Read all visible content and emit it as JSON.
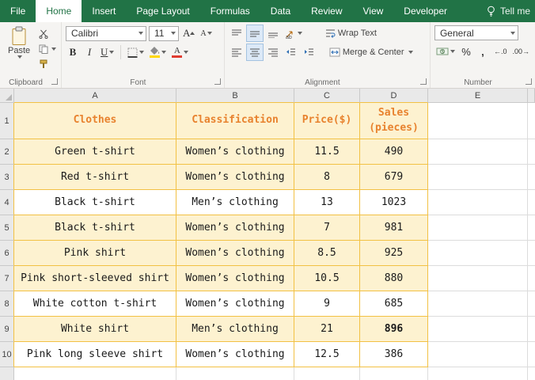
{
  "colors": {
    "excel_green": "#217346",
    "table_border": "#f2c144",
    "header_fill": "#fdf2d0",
    "header_text": "#e8822e"
  },
  "ribbon": {
    "tabs": [
      "File",
      "Home",
      "Insert",
      "Page Layout",
      "Formulas",
      "Data",
      "Review",
      "View",
      "Developer"
    ],
    "active_tab": "Home",
    "tell_me": "Tell me",
    "groups": {
      "clipboard": {
        "label": "Clipboard",
        "paste": "Paste"
      },
      "font": {
        "label": "Font",
        "name": "Calibri",
        "size": "11",
        "bold": "B",
        "italic": "I",
        "underline": "U"
      },
      "alignment": {
        "label": "Alignment",
        "wrap_text": "Wrap Text",
        "merge_center": "Merge & Center"
      },
      "number": {
        "label": "Number",
        "format": "General",
        "percent": "%",
        "comma": ","
      }
    }
  },
  "icons": {
    "letter_a": "A",
    "increase_decimal": "←.0",
    "decrease_decimal": ".00→"
  },
  "sheet": {
    "column_letters": [
      "A",
      "B",
      "C",
      "D",
      "E"
    ],
    "header_row_number": "1",
    "headers": [
      "Clothes",
      "Classification",
      "Price($)",
      "Sales (pieces)"
    ],
    "rows": [
      {
        "n": "2",
        "cells": [
          "Green t-shirt",
          "Women’s clothing",
          "11.5",
          "490"
        ],
        "fill": true
      },
      {
        "n": "3",
        "cells": [
          "Red t-shirt",
          "Women’s clothing",
          "8",
          "679"
        ],
        "fill": true
      },
      {
        "n": "4",
        "cells": [
          "Black t-shirt",
          "Men’s clothing",
          "13",
          "1023"
        ],
        "fill": false
      },
      {
        "n": "5",
        "cells": [
          "Black t-shirt",
          "Women’s clothing",
          "7",
          "981"
        ],
        "fill": true
      },
      {
        "n": "6",
        "cells": [
          "Pink shirt",
          "Women’s clothing",
          "8.5",
          "925"
        ],
        "fill": true
      },
      {
        "n": "7",
        "cells": [
          "Pink short-sleeved shirt",
          "Women’s clothing",
          "10.5",
          "880"
        ],
        "fill": true
      },
      {
        "n": "8",
        "cells": [
          "White cotton t-shirt",
          "Women’s clothing",
          "9",
          "685"
        ],
        "fill": false
      },
      {
        "n": "9",
        "cells": [
          "White shirt",
          "Men’s clothing",
          "21",
          "896"
        ],
        "fill": true,
        "bold": [
          3
        ]
      },
      {
        "n": "10",
        "cells": [
          "Pink long sleeve shirt",
          "Women’s clothing",
          "12.5",
          "386"
        ],
        "fill": false
      }
    ]
  }
}
